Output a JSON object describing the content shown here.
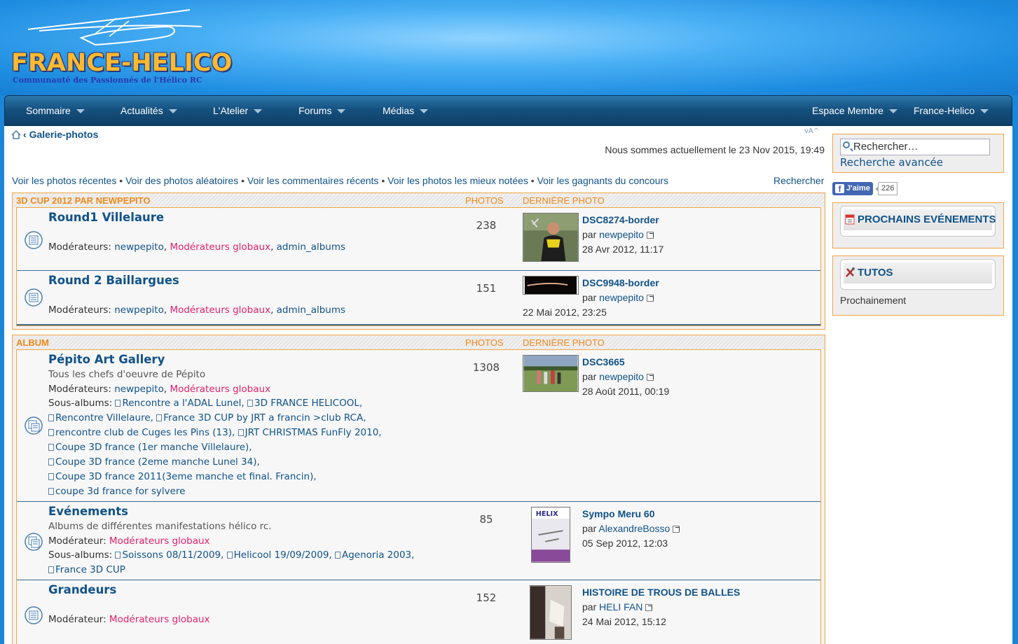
{
  "header": {
    "logo_title": "FRANCE-HELICO",
    "logo_subtitle": "Communauté des Passionnés de l'Hélico RC"
  },
  "nav": {
    "items": [
      {
        "label": "Sommaire"
      },
      {
        "label": "Actualités"
      },
      {
        "label": "L'Atelier"
      },
      {
        "label": "Forums"
      },
      {
        "label": "Médias"
      }
    ],
    "right": [
      {
        "label": "Espace Membre"
      },
      {
        "label": "France-Helico"
      }
    ]
  },
  "breadcrumb": {
    "sep": "‹",
    "current": "Galerie-photos"
  },
  "fontsize_glyph": "vA^",
  "datetime": "Nous sommes actuellement le 23 Nov 2015, 19:49",
  "quicklinks": [
    "Voir les photos récentes",
    "Voir des photos aléatoires",
    "Voir les commentaires récents",
    "Voir les photos les mieux notées",
    "Voir les gagnants du concours"
  ],
  "quicklinks_sep": " • ",
  "search_link": "Rechercher",
  "headers": {
    "photos": "PHOTOS",
    "last": "DERNIÈRE PHOTO"
  },
  "categories": [
    {
      "name": "3D CUP 2012 PAR NEWPEPITO",
      "forums": [
        {
          "title": "Round1 Villelaure",
          "mods_label": "Modérateurs:",
          "mods": [
            "newpepito",
            "Modérateurs globaux",
            "admin_albums"
          ],
          "count": "238",
          "last": {
            "title": "DSC8274-border",
            "by": "par",
            "author": "newpepito",
            "date": "28 Avr 2012, 11:17"
          }
        },
        {
          "title": "Round 2 Baillargues",
          "mods_label": "Modérateurs:",
          "mods": [
            "newpepito",
            "Modérateurs globaux",
            "admin_albums"
          ],
          "count": "151",
          "last": {
            "title": "DSC9948-border",
            "by": "par",
            "author": "newpepito",
            "date": "22 Mai 2012, 23:25"
          }
        }
      ]
    },
    {
      "name": "ALBUM",
      "forums": [
        {
          "title": "Pépito Art Gallery",
          "desc": "Tous les chefs d'oeuvre de Pépito",
          "mods_label": "Modérateurs:",
          "mods": [
            "newpepito",
            "Modérateurs globaux"
          ],
          "sub_label": "Sous-albums:",
          "subs": [
            "Rencontre a l'ADAL Lunel,",
            "3D FRANCE HELICOOL,",
            "Rencontre Villelaure,",
            "France 3D CUP by JRT a francin >club RCA,",
            "rencontre club de Cuges les Pins (13),",
            "JRT CHRISTMAS FunFly 2010,",
            "Coupe 3D france (1er manche Villelaure),",
            "Coupe 3D france (2eme manche Lunel 34),",
            "Coupe 3D france 2011(3eme manche et final. Francin),",
            "coupe 3d france for sylvere"
          ],
          "count": "1308",
          "last": {
            "title": "DSC3665",
            "by": "par",
            "author": "newpepito",
            "date": "28 Août 2011, 00:19"
          }
        },
        {
          "title": "Evénements",
          "desc": "Albums de différentes manifestations hélico rc.",
          "mods_label": "Modérateur:",
          "mods": [
            "Modérateurs globaux"
          ],
          "sub_label": "Sous-albums:",
          "subs": [
            "Soissons 08/11/2009,",
            "Helicool 19/09/2009,",
            "Agenoria 2003,",
            "France 3D CUP"
          ],
          "count": "85",
          "last": {
            "title": "Sympo Meru 60",
            "by": "par",
            "author": "AlexandreBosso",
            "date": "05 Sep 2012, 12:03"
          }
        },
        {
          "title": "Grandeurs",
          "mods_label": "Modérateur:",
          "mods": [
            "Modérateurs globaux"
          ],
          "count": "152",
          "last": {
            "title": "HISTOIRE DE TROUS DE BALLES",
            "by": "par",
            "author": "HELI FAN",
            "date": "24 Mai 2012, 15:12"
          }
        }
      ]
    }
  ],
  "sidebar": {
    "search_placeholder": "Rechercher…",
    "advanced_search": "Recherche avancée",
    "fb_like": "J'aime",
    "fb_count": "226",
    "events_title": "PROCHAINS EVÉNEMENTS",
    "tutos_title": "TUTOS",
    "tutos_text": "Prochainement"
  }
}
